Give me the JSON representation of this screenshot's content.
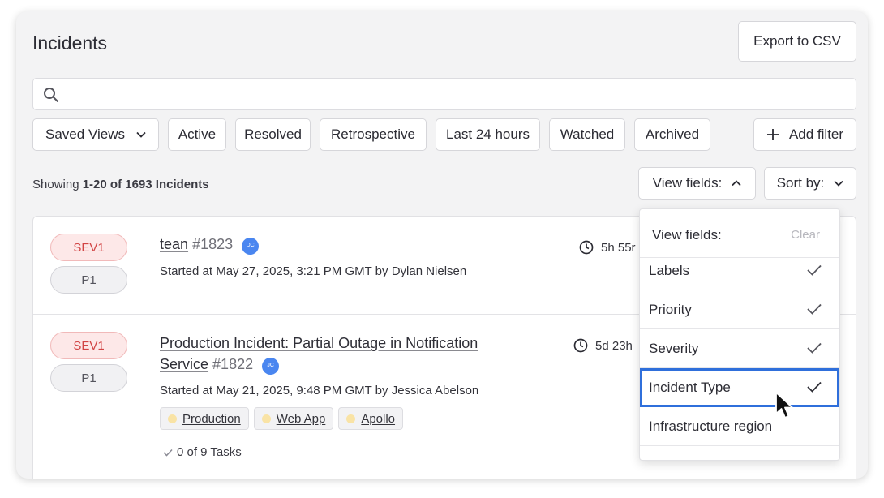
{
  "page": {
    "title": "Incidents",
    "export_label": "Export to CSV"
  },
  "search": {
    "placeholder": ""
  },
  "filters": {
    "saved_views": "Saved Views",
    "active": "Active",
    "resolved": "Resolved",
    "retrospective": "Retrospective",
    "last24": "Last 24 hours",
    "watched": "Watched",
    "archived": "Archived",
    "add_filter": "Add filter"
  },
  "summary": {
    "prefix": "Showing",
    "range": "1-20 of 1693 Incidents"
  },
  "view_fields_label": "View fields:",
  "sort_by_label": "Sort by:",
  "incidents": [
    {
      "severity": "SEV1",
      "priority": "P1",
      "name": "tean",
      "number": "#1823",
      "avatar": "DC",
      "started": "Started at May 27, 2025, 3:21 PM GMT by Dylan Nielsen",
      "duration": "5h 55r"
    },
    {
      "severity": "SEV1",
      "priority": "P1",
      "name_line1": "Production Incident: Partial Outage in Notification",
      "name_line2": "Service",
      "number": "#1822",
      "avatar": "JC",
      "started": "Started at May 21, 2025, 9:48 PM GMT by Jessica Abelson",
      "duration": "5d 23h",
      "tags": [
        "Production",
        "Web App",
        "Apollo"
      ],
      "tasks": "0 of 9 Tasks"
    }
  ],
  "view_fields_menu": {
    "title": "View fields:",
    "clear": "Clear",
    "items": [
      {
        "label": "Labels",
        "checked": true
      },
      {
        "label": "Priority",
        "checked": true
      },
      {
        "label": "Severity",
        "checked": true
      },
      {
        "label": "Incident Type",
        "checked": true,
        "highlighted": true
      },
      {
        "label": "Infrastructure region",
        "checked": false
      }
    ]
  },
  "colors": {
    "accent": "#2f6fdb",
    "severity_red": "#d24545",
    "avatar_blue": "#4a86f0",
    "tag_dot": "#f9e3a5"
  }
}
